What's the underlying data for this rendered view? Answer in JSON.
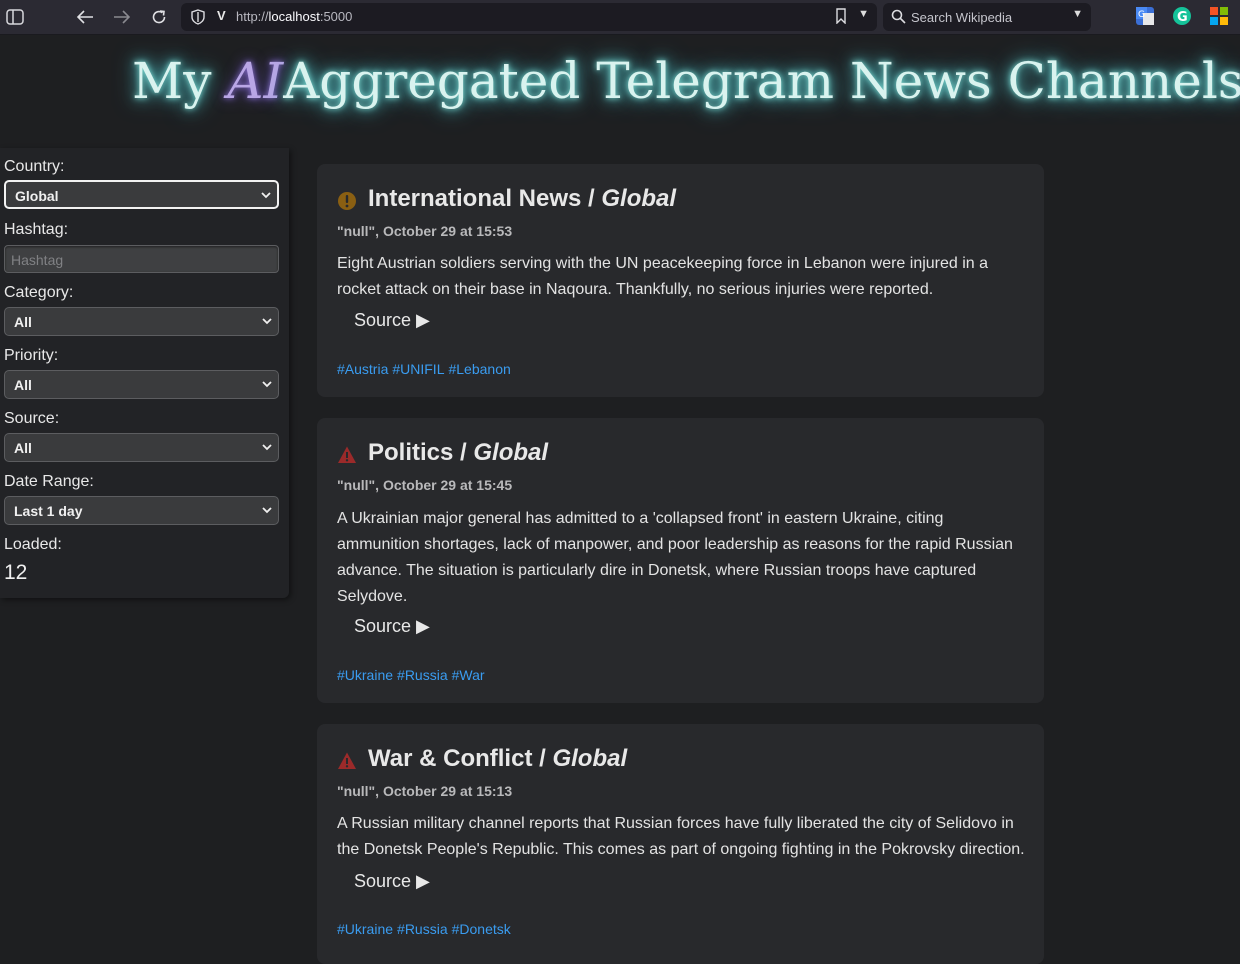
{
  "browser": {
    "url_prefix": "http://",
    "url_host": "localhost",
    "url_port": ":5000",
    "search_placeholder": "Search Wikipedia"
  },
  "header": {
    "title_pre": "My ",
    "title_ai": "AI",
    "title_main": "Aggregated Telegram News Channels",
    "title_bang": "!"
  },
  "sidebar": {
    "country_label": "Country:",
    "country_value": "Global",
    "hashtag_label": "Hashtag:",
    "hashtag_placeholder": "Hashtag",
    "category_label": "Category:",
    "category_value": "All",
    "priority_label": "Priority:",
    "priority_value": "All",
    "source_label": "Source:",
    "source_value": "All",
    "daterange_label": "Date Range:",
    "daterange_value": "Last 1 day",
    "loaded_label": "Loaded:",
    "loaded_value": "12"
  },
  "cards": [
    {
      "priority_icon": "exclamation-circle-icon",
      "priority_color": "#9a6a14",
      "category": "International News",
      "sep": " / ",
      "location": "Global",
      "meta": "\"null\", October 29 at 15:53",
      "body": "Eight Austrian soldiers serving with the UN peacekeeping force in Lebanon were injured in a rocket attack on their base in Naqoura. Thankfully, no serious injuries were reported.",
      "source_label": "Source ▶",
      "tags": [
        "#Austria",
        "#UNIFIL",
        "#Lebanon"
      ]
    },
    {
      "priority_icon": "warning-triangle-icon",
      "priority_color": "#9b2a2a",
      "category": "Politics",
      "sep": " / ",
      "location": "Global",
      "meta": "\"null\", October 29 at 15:45",
      "body": "A Ukrainian major general has admitted to a 'collapsed front' in eastern Ukraine, citing ammunition shortages, lack of manpower, and poor leadership as reasons for the rapid Russian advance. The situation is particularly dire in Donetsk, where Russian troops have captured Selydove.",
      "source_label": "Source ▶",
      "tags": [
        "#Ukraine",
        "#Russia",
        "#War"
      ]
    },
    {
      "priority_icon": "warning-triangle-icon",
      "priority_color": "#9b2a2a",
      "category": "War & Conflict",
      "sep": " / ",
      "location": "Global",
      "meta": "\"null\", October 29 at 15:13",
      "body": "A Russian military channel reports that Russian forces have fully liberated the city of Selidovo in the Donetsk People's Republic. This comes as part of ongoing fighting in the Pokrovsky direction.",
      "source_label": "Source ▶",
      "tags": [
        "#Ukraine",
        "#Russia",
        "#Donetsk"
      ]
    }
  ]
}
